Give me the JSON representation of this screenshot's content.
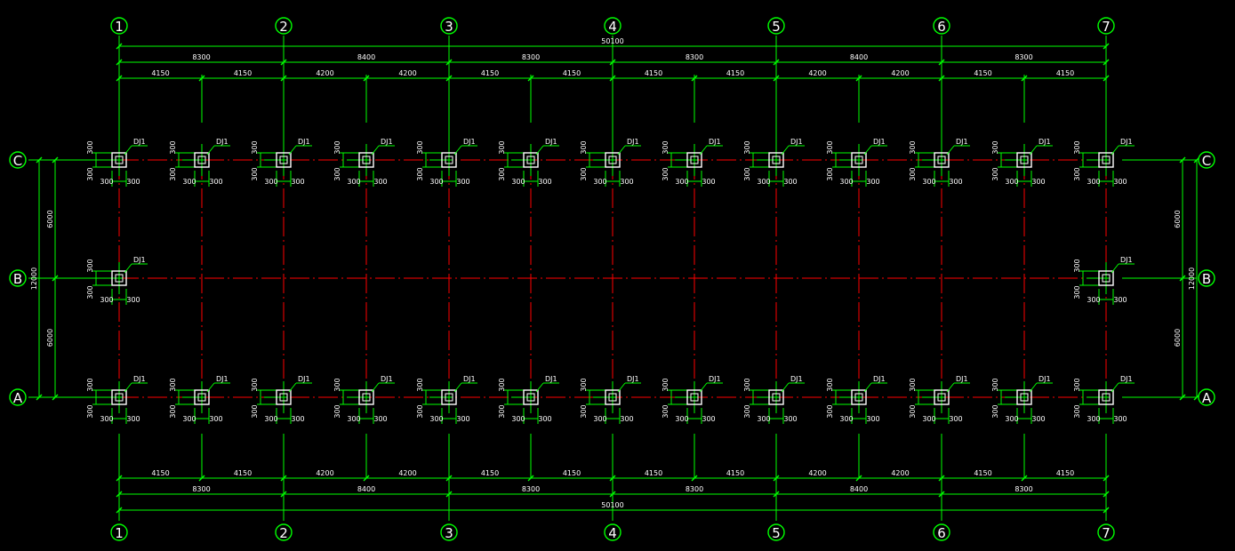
{
  "drawing": {
    "colors": {
      "background": "#000000",
      "dimension": "#00ff00",
      "axis": "#ff0000",
      "column": "#ffffff",
      "column_core": "#ff0000",
      "text": "#ffffff"
    },
    "column_grid_labels": [
      "1",
      "2",
      "3",
      "4",
      "5",
      "6",
      "7"
    ],
    "row_grid_labels": [
      "C",
      "B",
      "A"
    ],
    "dimensions": {
      "overall_length": "50100",
      "bays": [
        "8300",
        "8400",
        "8300",
        "8300",
        "8400",
        "8300"
      ],
      "half_bays": [
        "4150",
        "4150",
        "4200",
        "4200",
        "4150",
        "4150",
        "4150",
        "4150",
        "4200",
        "4200",
        "4150",
        "4150"
      ],
      "overall_depth": "12000",
      "depth_spans": [
        "6000",
        "6000"
      ]
    },
    "column_tag": "DJ1",
    "footing_offset": "300"
  }
}
